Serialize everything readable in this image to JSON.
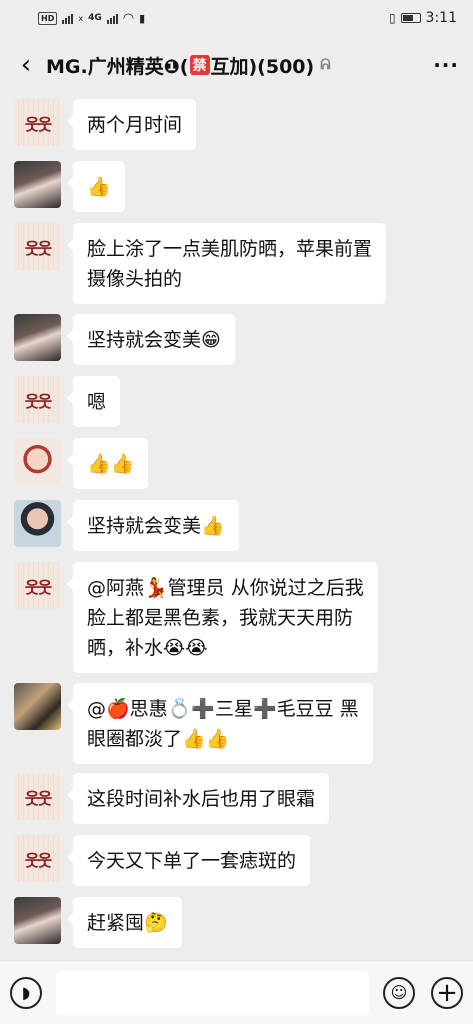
{
  "status_bar": {
    "hd1": "HD",
    "sig1": "x",
    "sig2": "4G",
    "time": "3:11"
  },
  "header": {
    "title_prefix": "MG.广州精英❶(",
    "ban_glyph": "禁",
    "title_suffix": "互加)(500)",
    "mute_glyph": "🔇",
    "back_glyph": "‹",
    "more_glyph": "···"
  },
  "messages": [
    {
      "avatar": "avatar-red-figures",
      "text": "两个月时间"
    },
    {
      "avatar": "avatar-woman-photo",
      "text": "👍"
    },
    {
      "avatar": "avatar-red-figures",
      "text": "脸上涂了一点美肌防晒，苹果前置\n摄像头拍的"
    },
    {
      "avatar": "avatar-woman-photo",
      "text": "坚持就会变美😁"
    },
    {
      "avatar": "avatar-red-figures",
      "text": "嗯"
    },
    {
      "avatar": "avatar-woman-red-photo",
      "text": "👍👍"
    },
    {
      "avatar": "avatar-woman-dark-photo",
      "text": "坚持就会变美👍"
    },
    {
      "avatar": "avatar-red-figures",
      "text": "@阿燕💃管理员  从你说过之后我\n脸上都是黑色素，我就天天用防\n晒，补水😭😭"
    },
    {
      "avatar": "avatar-group-photo",
      "text": "@🍎思惠💍➕三星➕毛豆豆  黑\n眼圈都淡了👍👍"
    },
    {
      "avatar": "avatar-red-figures",
      "text": "这段时间补水后也用了眼霜"
    },
    {
      "avatar": "avatar-red-figures",
      "text": "今天又下单了一套痣斑的"
    },
    {
      "avatar": "avatar-woman-photo",
      "text": "赶紧囤🤔"
    }
  ],
  "input_bar": {
    "voice_glyph": "🔊",
    "emoji_glyph": "☺",
    "plus_glyph": "+"
  }
}
